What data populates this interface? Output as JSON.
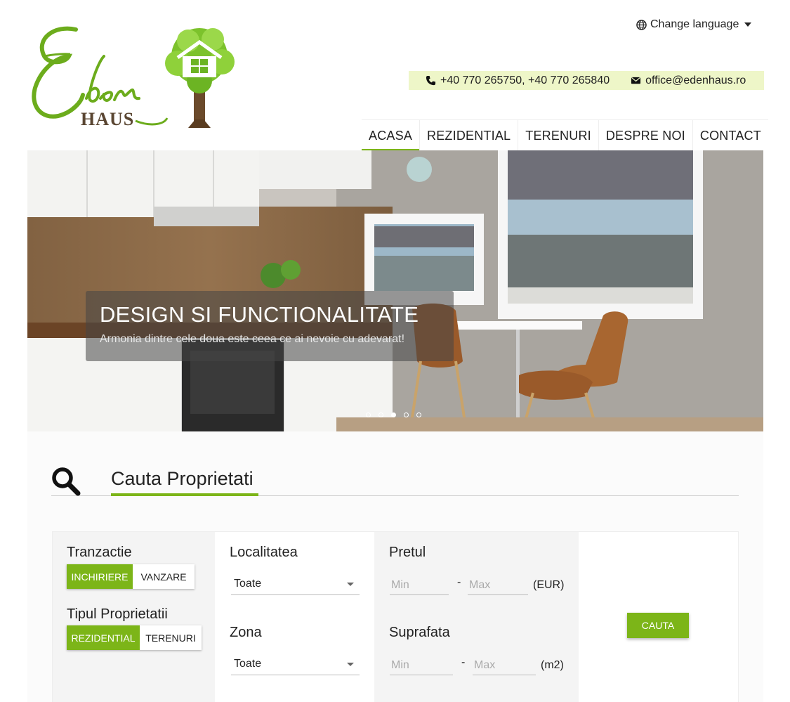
{
  "header": {
    "language_label": "Change language",
    "phone": "+40 770 265750, +40 770 265840",
    "email": "office@edenhaus.ro",
    "logo_text": "Eden HAUS"
  },
  "nav": {
    "items": [
      {
        "label": "ACASA",
        "active": true
      },
      {
        "label": "REZIDENTIAL",
        "active": false
      },
      {
        "label": "TERENURI",
        "active": false
      },
      {
        "label": "DESPRE NOI",
        "active": false
      },
      {
        "label": "CONTACT",
        "active": false
      }
    ]
  },
  "hero": {
    "title": "DESIGN SI FUNCTIONALITATE",
    "subtitle": "Armonia dintre cele doua este ceea ce ai nevoie cu adevarat!",
    "slides_count": 5,
    "active_slide": 3
  },
  "search": {
    "title": "Cauta Proprietati",
    "tranzactie_label": "Tranzactie",
    "tranzactie_options": [
      "INCHIRIERE",
      "VANZARE"
    ],
    "tipul_label": "Tipul Proprietatii",
    "tipul_options": [
      "REZIDENTIAL",
      "TERENURI"
    ],
    "localitatea_label": "Localitatea",
    "localitatea_value": "Toate",
    "zona_label": "Zona",
    "zona_value": "Toate",
    "pretul_label": "Pretul",
    "pretul_min_placeholder": "Min",
    "pretul_max_placeholder": "Max",
    "pretul_unit": "(EUR)",
    "suprafata_label": "Suprafata",
    "suprafata_min_placeholder": "Min",
    "suprafata_max_placeholder": "Max",
    "suprafata_unit": "(m2)",
    "dash": "-",
    "button_label": "CAUTA"
  },
  "colors": {
    "accent": "#7cb518",
    "contact_bar_bg": "#eef6c8"
  }
}
